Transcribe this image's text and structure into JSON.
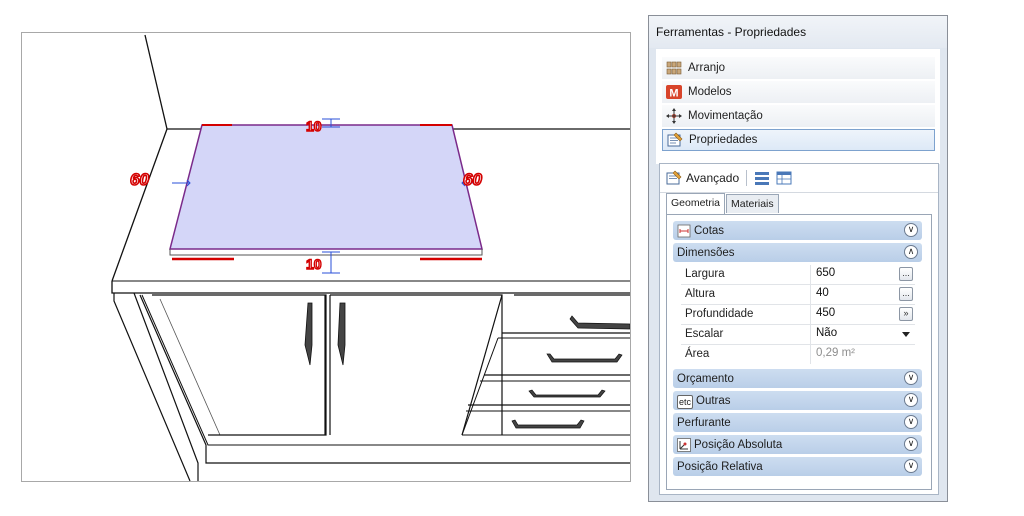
{
  "viewport": {
    "dimension_left": "60",
    "dimension_right": "60",
    "dimension_top": "10",
    "dimension_bottom": "10"
  },
  "panel": {
    "title": "Ferramentas - Propriedades",
    "categories": [
      {
        "label": "Arranjo",
        "icon": "arranjo-icon"
      },
      {
        "label": "Modelos",
        "icon": "modelos-icon"
      },
      {
        "label": "Movimentação",
        "icon": "move-icon"
      },
      {
        "label": "Propriedades",
        "icon": "properties-icon",
        "selected": true
      }
    ],
    "advanced_label": "Avançado",
    "tabs": [
      "Geometria",
      "Materiais"
    ],
    "active_tab": "Geometria",
    "groups": {
      "cotas": "Cotas",
      "dimensoes": "Dimensões",
      "orcamento": "Orçamento",
      "outras": "Outras",
      "outras_icon_text": "etc",
      "perfurante": "Perfurante",
      "posicao_absoluta": "Posição Absoluta",
      "posicao_relativa": "Posição Relativa"
    },
    "properties": {
      "largura": {
        "name": "Largura",
        "value": "650",
        "button": "..."
      },
      "altura": {
        "name": "Altura",
        "value": "40",
        "button": "..."
      },
      "profundidade": {
        "name": "Profundidade",
        "value": "450",
        "button": "»"
      },
      "escalar": {
        "name": "Escalar",
        "value": "Não"
      },
      "area": {
        "name": "Área",
        "value": "0,29 m²"
      }
    }
  },
  "colors": {
    "countertop_fill": "#d4d6f8",
    "countertop_edge": "#7a2a8a",
    "dimension_red": "#d40000",
    "dimension_blue": "#2a4fd8",
    "panel_bg": "#dfe6ef",
    "group_header": "#c4d6ec"
  }
}
